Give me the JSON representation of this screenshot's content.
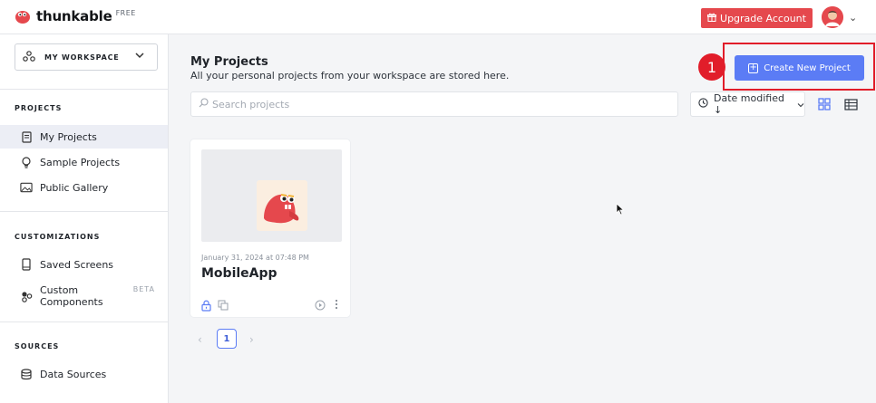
{
  "brand": {
    "name": "thunkable",
    "badge": "FREE",
    "color": "#e5484d"
  },
  "header": {
    "upgrade_label": "Upgrade Account",
    "upgrade_icon": "gift-icon",
    "avatar_icon": "user-avatar",
    "avatar_caret_icon": "chevron-down-icon"
  },
  "sidebar": {
    "workspace_label": "MY WORKSPACE",
    "sections": {
      "projects": "PROJECTS",
      "customizations": "CUSTOMIZATIONS",
      "sources": "SOURCES"
    },
    "items": {
      "my_projects": "My Projects",
      "sample_projects": "Sample Projects",
      "public_gallery": "Public Gallery",
      "saved_screens": "Saved Screens",
      "custom_components": "Custom",
      "custom_components_2": "Components",
      "custom_components_badge": "BETA",
      "data_sources": "Data Sources"
    }
  },
  "main": {
    "title": "My Projects",
    "subtitle": "All your personal projects from your workspace are stored here.",
    "create_button": "Create New Project",
    "step_number": "1",
    "search_placeholder": "Search projects",
    "sort_label": "Date modified ↓",
    "view_mode": "grid"
  },
  "projects": [
    {
      "date": "January 31, 2024 at 07:48 PM",
      "name": "MobileApp"
    }
  ],
  "pagination": {
    "current": "1"
  },
  "colors": {
    "accent": "#5b7cf5",
    "highlight": "#e11d2a",
    "active_nav_bg": "#eceef5"
  }
}
